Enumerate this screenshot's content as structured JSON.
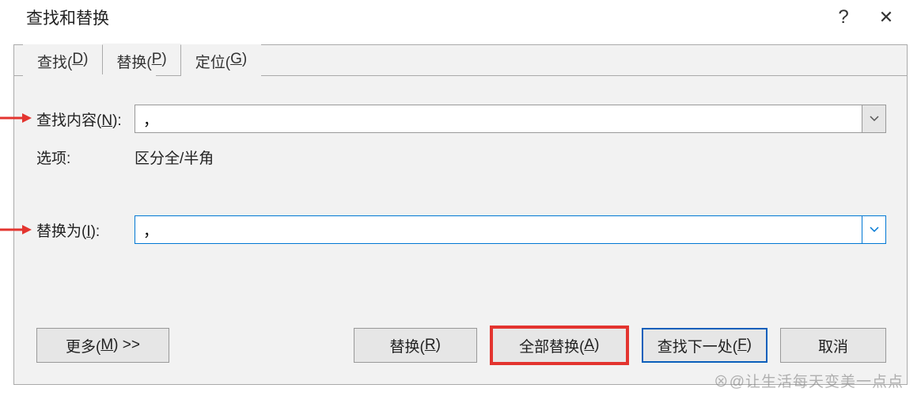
{
  "title": "查找和替换",
  "help_symbol": "?",
  "close_symbol": "✕",
  "tabs": [
    {
      "prefix": "查找(",
      "mn": "D",
      "suffix": ")"
    },
    {
      "prefix": "替换(",
      "mn": "P",
      "suffix": ")"
    },
    {
      "prefix": "定位(",
      "mn": "G",
      "suffix": ")"
    }
  ],
  "find": {
    "label_pre": "查找内容(",
    "label_mn": "N",
    "label_post": "):",
    "value": "，"
  },
  "options": {
    "label": "选项:",
    "value": "区分全/半角"
  },
  "replace": {
    "label_pre": "替换为(",
    "label_mn": "I",
    "label_post": "):",
    "value": "，"
  },
  "buttons": {
    "more_pre": "更多(",
    "more_mn": "M",
    "more_post": ") >>",
    "replace_pre": "替换(",
    "replace_mn": "R",
    "replace_post": ")",
    "replace_all_pre": "全部替换(",
    "replace_all_mn": "A",
    "replace_all_post": ")",
    "find_next_pre": "查找下一处(",
    "find_next_mn": "F",
    "find_next_post": ")",
    "cancel": "取消"
  },
  "watermark": "⊗@让生活每天变美一点点"
}
